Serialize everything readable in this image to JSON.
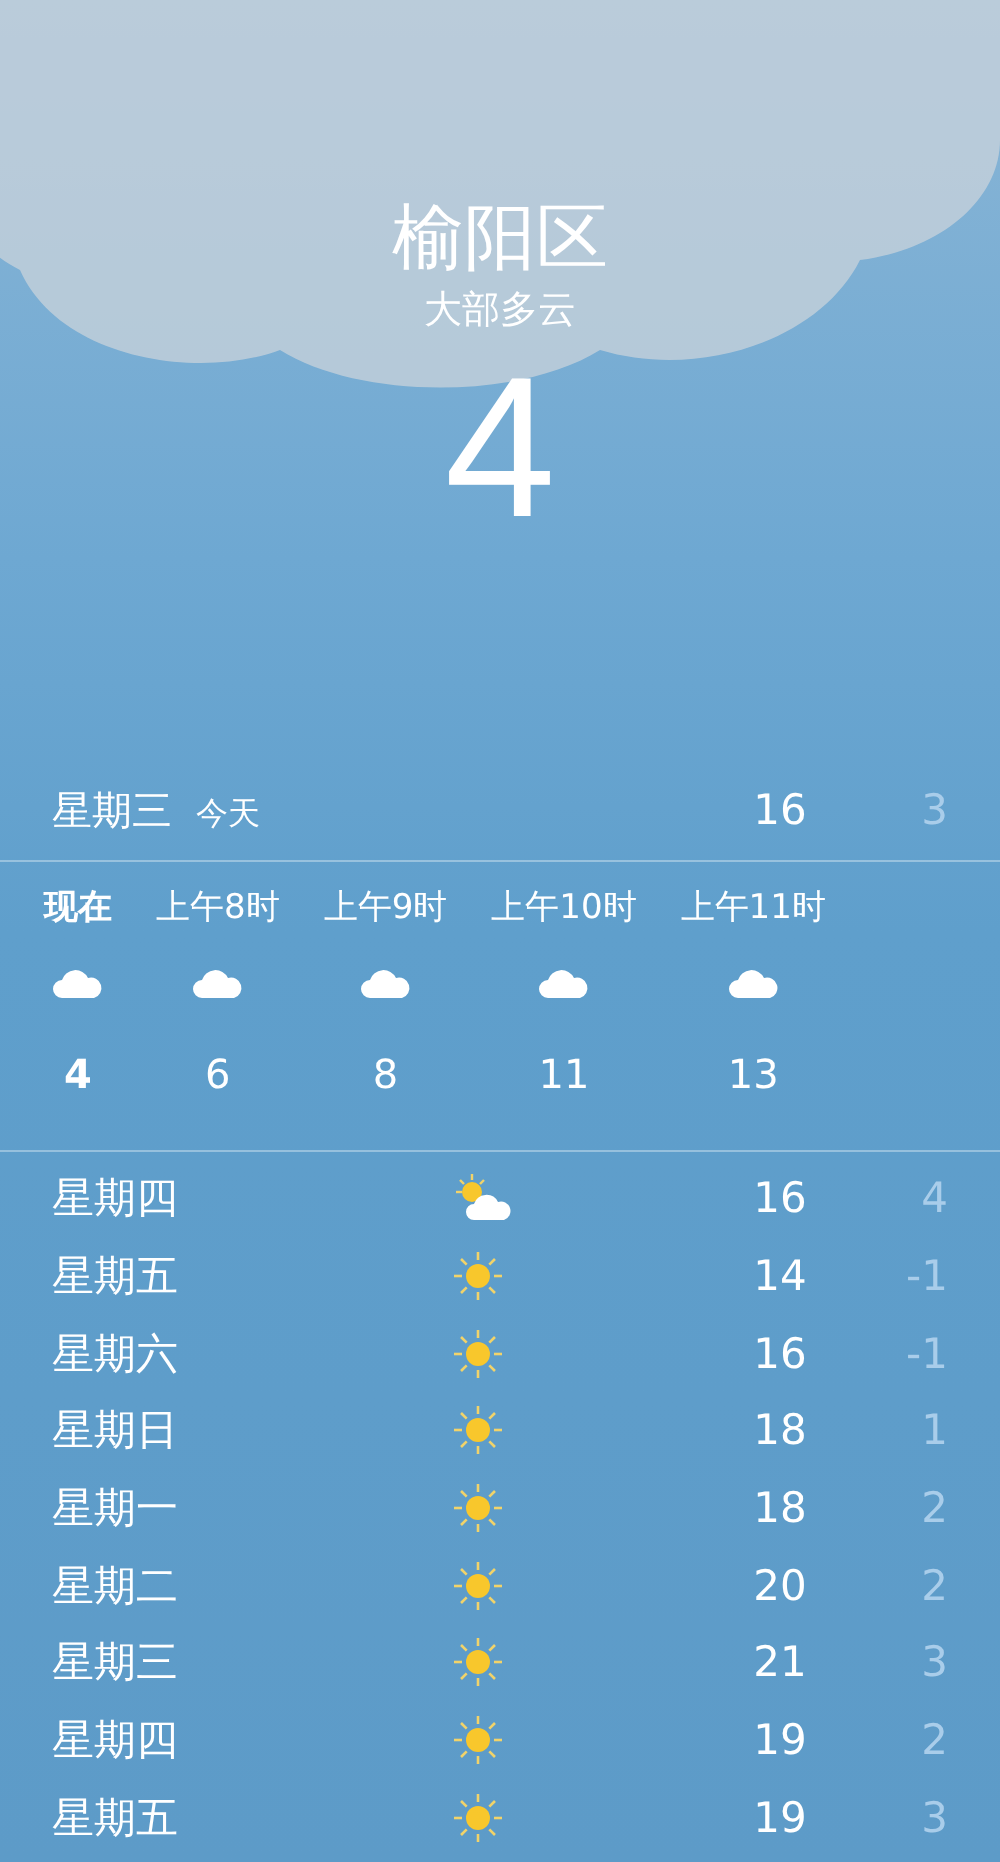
{
  "location": {
    "city": "榆阳区",
    "condition": "大部多云",
    "temperature": "4"
  },
  "today": {
    "day": "星期三",
    "label": "今天",
    "high": "16",
    "low": "3"
  },
  "hourly": [
    {
      "time": "现在",
      "kind": "cloudy",
      "temp": "4",
      "selected": true
    },
    {
      "time": "上午8时",
      "kind": "cloudy",
      "temp": "6",
      "selected": false
    },
    {
      "time": "上午9时",
      "kind": "cloudy",
      "temp": "8",
      "selected": false
    },
    {
      "time": "上午10时",
      "kind": "cloudy",
      "temp": "11",
      "selected": false
    },
    {
      "time": "上午11时",
      "kind": "cloudy",
      "temp": "13",
      "selected": false
    }
  ],
  "daily": [
    {
      "day": "星期四",
      "kind": "partly-sunny",
      "high": "16",
      "low": "4"
    },
    {
      "day": "星期五",
      "kind": "sunny",
      "high": "14",
      "low": "-1"
    },
    {
      "day": "星期六",
      "kind": "sunny",
      "high": "16",
      "low": "-1"
    },
    {
      "day": "星期日",
      "kind": "sunny",
      "high": "18",
      "low": "1"
    },
    {
      "day": "星期一",
      "kind": "sunny",
      "high": "18",
      "low": "2"
    },
    {
      "day": "星期二",
      "kind": "sunny",
      "high": "20",
      "low": "2"
    },
    {
      "day": "星期三",
      "kind": "sunny",
      "high": "21",
      "low": "3"
    },
    {
      "day": "星期四",
      "kind": "sunny",
      "high": "19",
      "low": "2"
    },
    {
      "day": "星期五",
      "kind": "sunny",
      "high": "19",
      "low": "3"
    }
  ]
}
